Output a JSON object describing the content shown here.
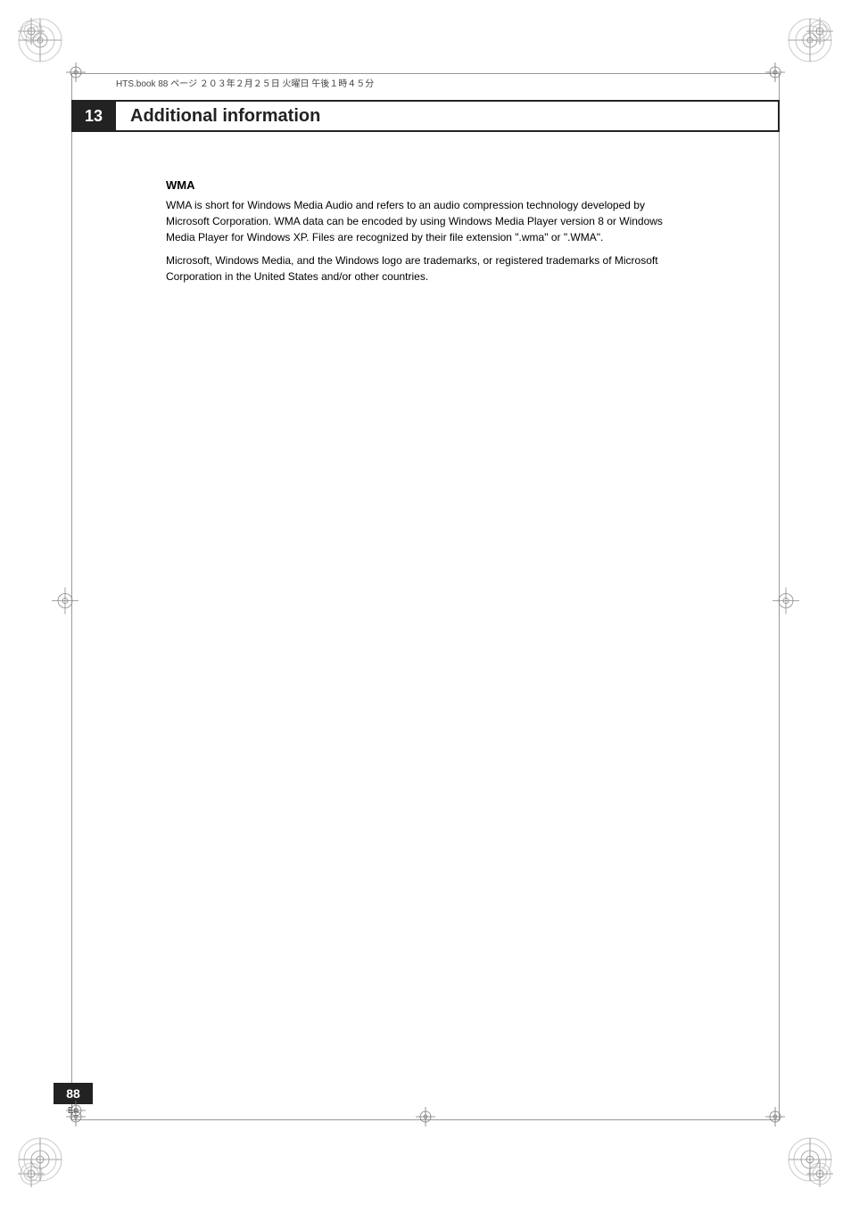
{
  "page": {
    "number": "88",
    "lang": "En"
  },
  "header": {
    "registration_text": "HTS.book  88 ページ  ２０３年２月２５日  火曜日  午後１時４５分",
    "chapter_number": "13",
    "chapter_title": "Additional information"
  },
  "content": {
    "section_title": "WMA",
    "paragraph1": "WMA is short for Windows Media Audio and refers to an audio compression technology developed by Microsoft Corporation. WMA data can be encoded by using Windows Media Player version 8 or Windows Media Player for Windows XP. Files are recognized by their file extension \".wma\" or \".WMA\".",
    "paragraph2": "Microsoft, Windows Media, and the Windows logo are trademarks, or registered trademarks of Microsoft Corporation in the United States and/or other countries."
  }
}
